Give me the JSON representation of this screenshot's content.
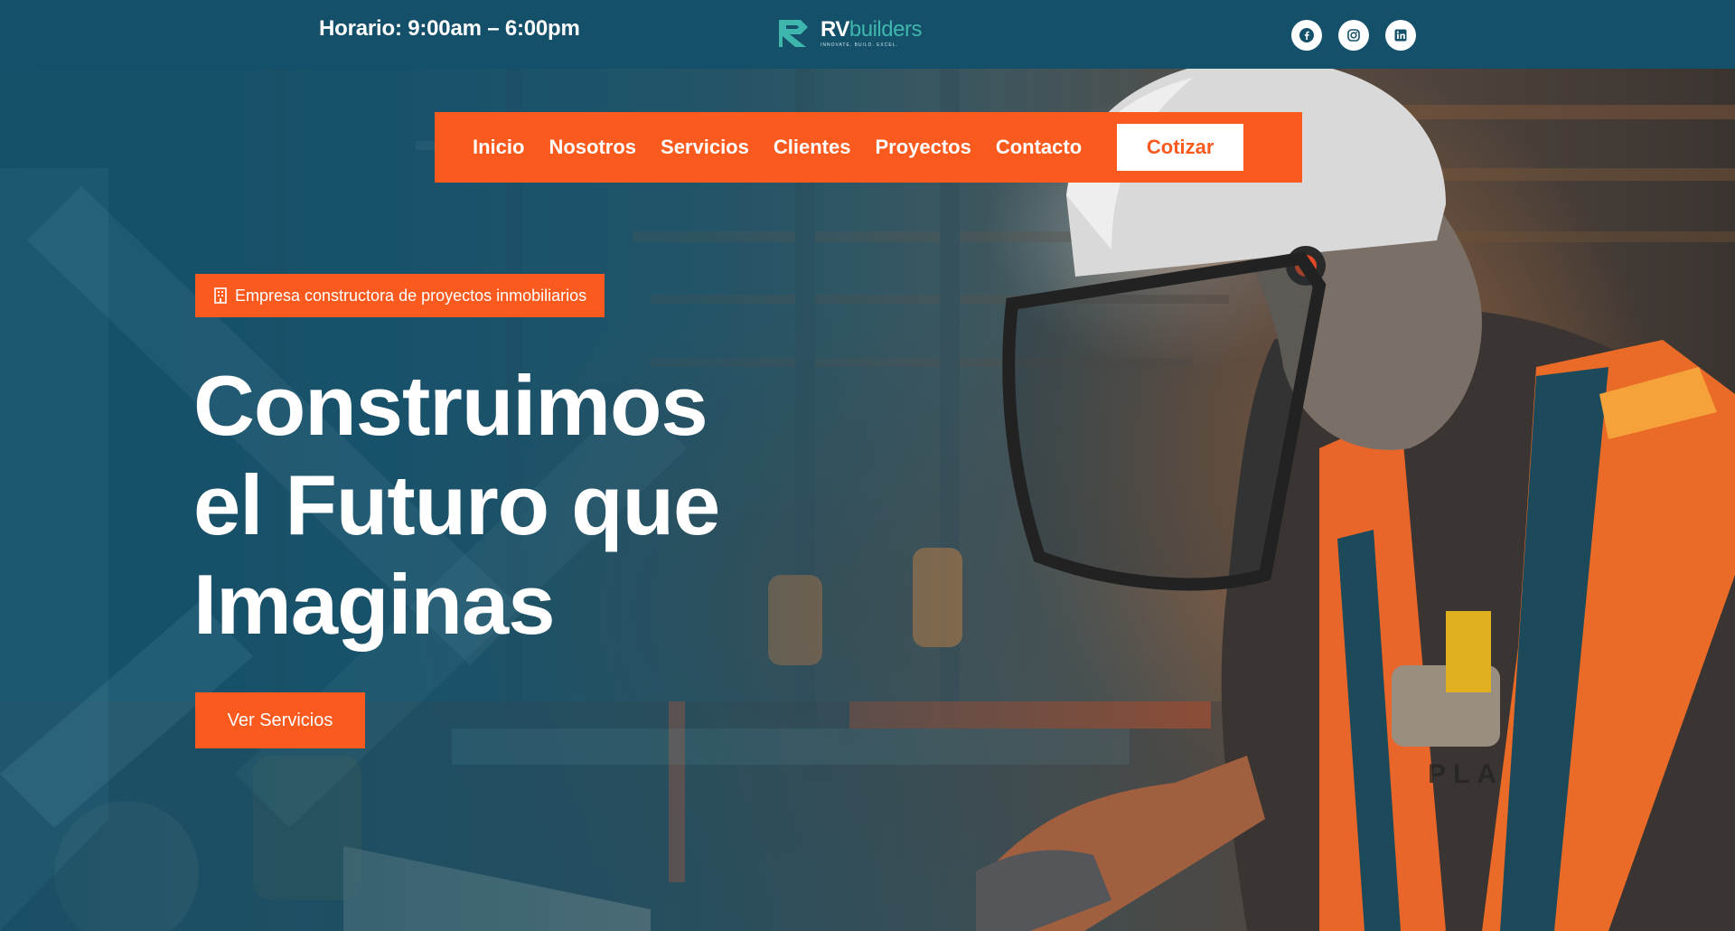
{
  "topbar": {
    "hours": "Horario: 9:00am – 6:00pm",
    "logo": {
      "name_bold": "RV",
      "name_light": "builders",
      "tagline": "INNOVATE. BUILD. EXCEL."
    },
    "socials": [
      {
        "icon": "facebook-icon"
      },
      {
        "icon": "instagram-icon"
      },
      {
        "icon": "linkedin-icon"
      }
    ]
  },
  "nav": {
    "items": [
      "Inicio",
      "Nosotros",
      "Servicios",
      "Clientes",
      "Proyectos",
      "Contacto"
    ],
    "cta": "Cotizar"
  },
  "hero": {
    "badge": "Empresa constructora de proyectos inmobiliarios",
    "badge_icon": "building-icon",
    "headline": [
      "Construimos",
      "el Futuro que",
      "Imaginas"
    ],
    "cta": "Ver Servicios"
  },
  "colors": {
    "topbar": "#15506a",
    "accent": "#fa5a1e",
    "brand_teal": "#3fb6ad"
  }
}
